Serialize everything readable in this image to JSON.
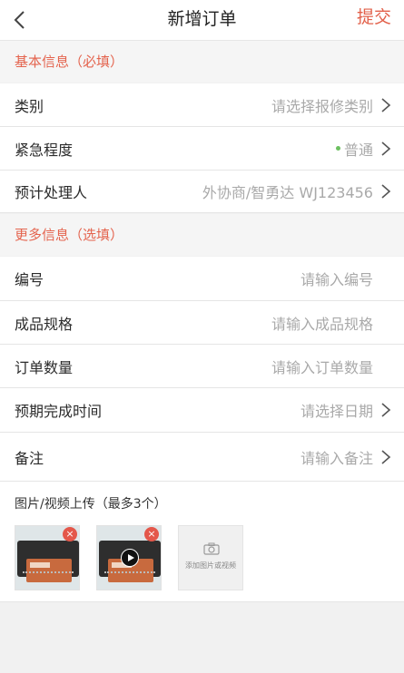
{
  "nav": {
    "title": "新增订单",
    "submit": "提交"
  },
  "sections": {
    "basic": "基本信息（必填）",
    "more": "更多信息（选填）"
  },
  "basic_rows": {
    "category": {
      "label": "类别",
      "value": "请选择报修类别"
    },
    "urgency": {
      "label": "紧急程度",
      "value": "普通",
      "status_color": "#6cc060"
    },
    "handler": {
      "label": "预计处理人",
      "value": "外协商/智勇达 WJ123456"
    }
  },
  "more_rows": {
    "number": {
      "label": "编号",
      "placeholder": "请输入编号"
    },
    "spec": {
      "label": "成品规格",
      "placeholder": "请输入成品规格"
    },
    "quantity": {
      "label": "订单数量",
      "placeholder": "请输入订单数量"
    },
    "due_date": {
      "label": "预期完成时间",
      "value": "请选择日期"
    },
    "remark": {
      "label": "备注",
      "placeholder": "请输入备注"
    }
  },
  "upload": {
    "title": "图片/视频上传（最多3个）",
    "add_label": "添加图片或视频",
    "delete_icon": "×"
  },
  "colors": {
    "accent": "#e2604a",
    "muted": "#a9a9a9"
  }
}
